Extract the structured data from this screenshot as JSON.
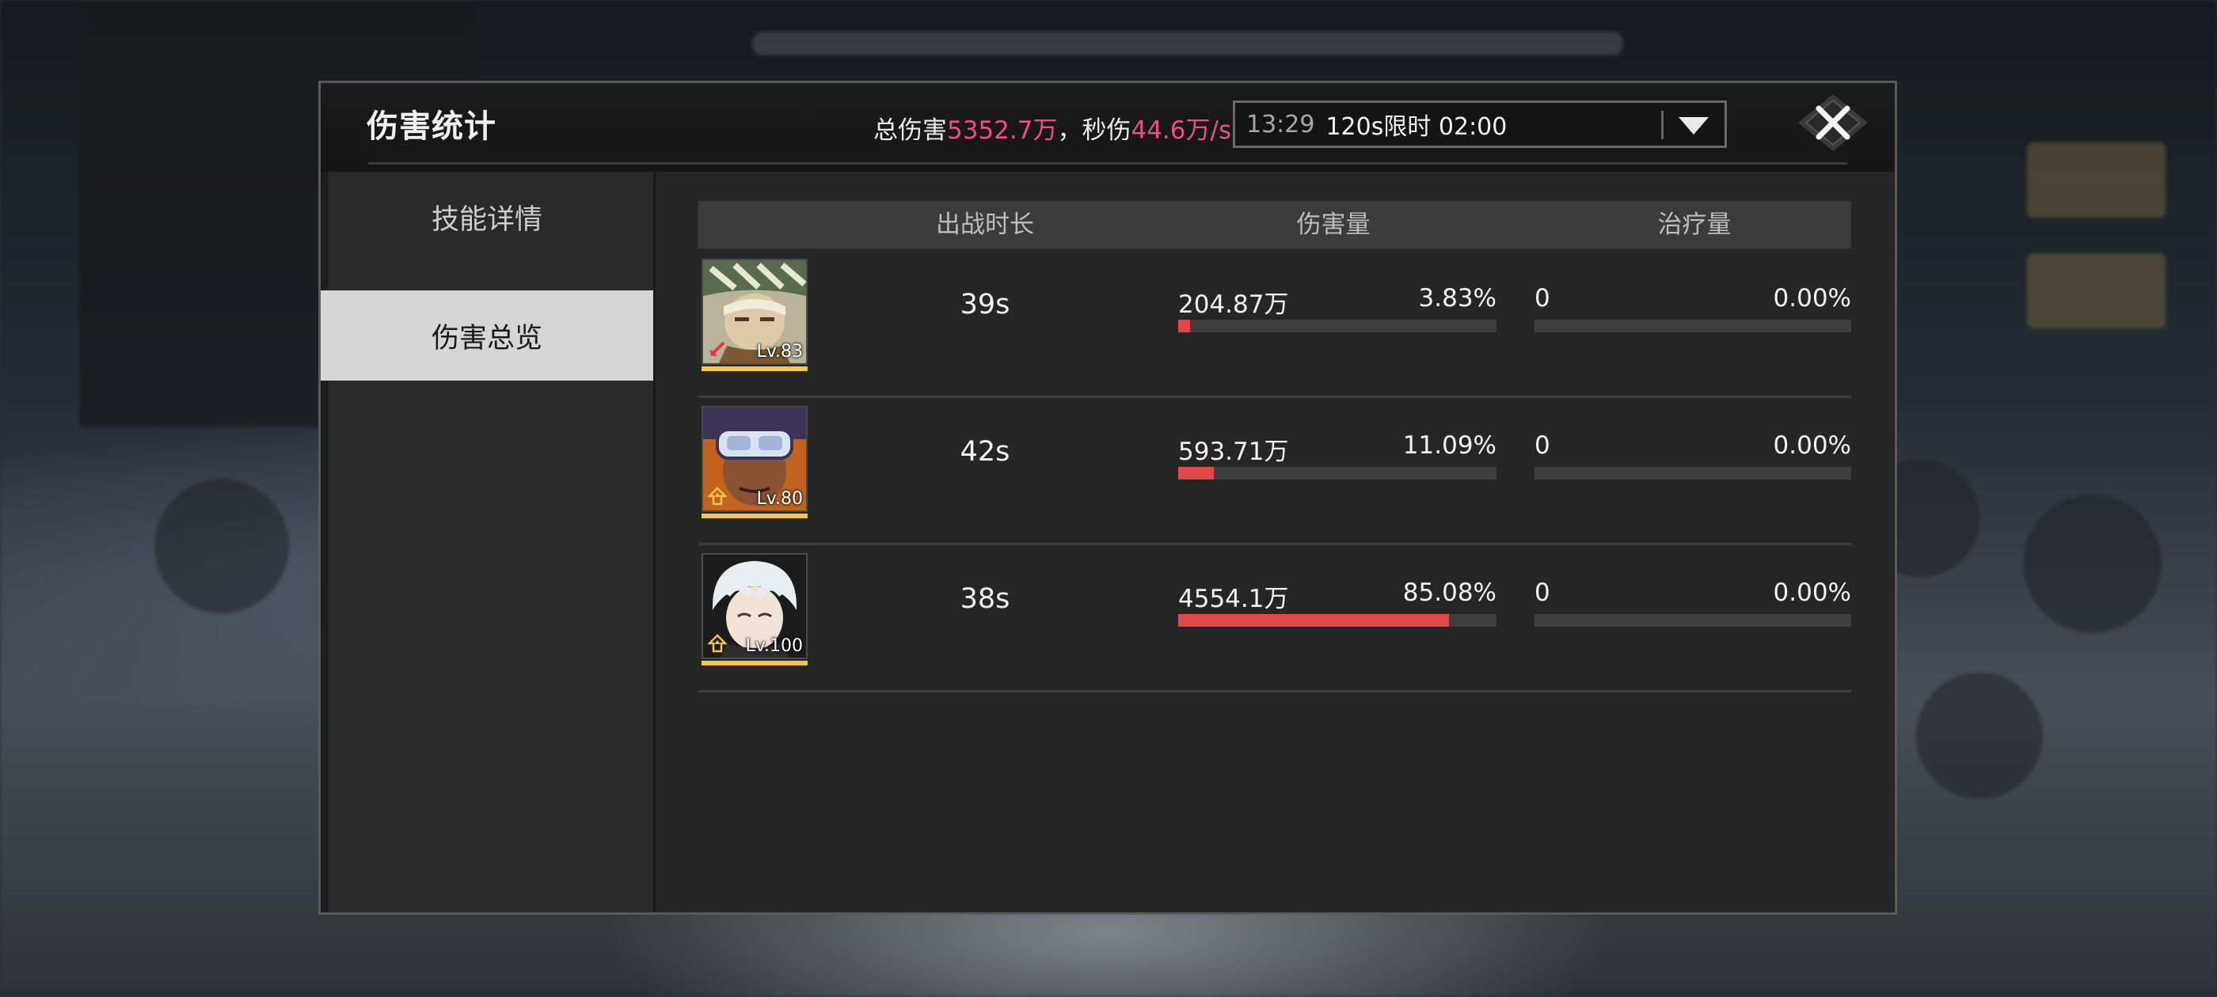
{
  "dialog": {
    "title": "伤害统计",
    "summary": {
      "total_label": "总伤害",
      "total_value": "5352.7万",
      "separator": "，",
      "dps_label": "秒伤",
      "dps_value": "44.6万/s"
    },
    "time_select": {
      "clock": "13:29",
      "label": "120s限时 02:00"
    },
    "close_icon": "close-x-icon"
  },
  "sidebar": {
    "tabs": [
      {
        "label": "技能详情",
        "active": false
      },
      {
        "label": "伤害总览",
        "active": true
      }
    ]
  },
  "table": {
    "headers": {
      "duration": "出战时长",
      "damage": "伤害量",
      "heal": "治疗量"
    },
    "rows": [
      {
        "level": "Lv.83",
        "duration": "39s",
        "damage": "204.87万",
        "damage_pct": "3.83%",
        "damage_share": 0.0383,
        "heal": "0",
        "heal_pct": "0.00%",
        "heal_share": 0,
        "badge": "red-slash-badge-icon"
      },
      {
        "level": "Lv.80",
        "duration": "42s",
        "damage": "593.71万",
        "damage_pct": "11.09%",
        "damage_share": 0.1109,
        "heal": "0",
        "heal_pct": "0.00%",
        "heal_share": 0,
        "badge": "gold-rank-badge-icon"
      },
      {
        "level": "Lv.100",
        "duration": "38s",
        "damage": "4554.1万",
        "damage_pct": "85.08%",
        "damage_share": 0.8508,
        "heal": "0",
        "heal_pct": "0.00%",
        "heal_share": 0,
        "badge": "gold-rank-badge-icon"
      }
    ]
  },
  "colors": {
    "accent_pink": "#ef4d86",
    "damage_bar": "#e04848",
    "level_bar": "#f1c64a",
    "active_tab": "#d6d6d6"
  }
}
